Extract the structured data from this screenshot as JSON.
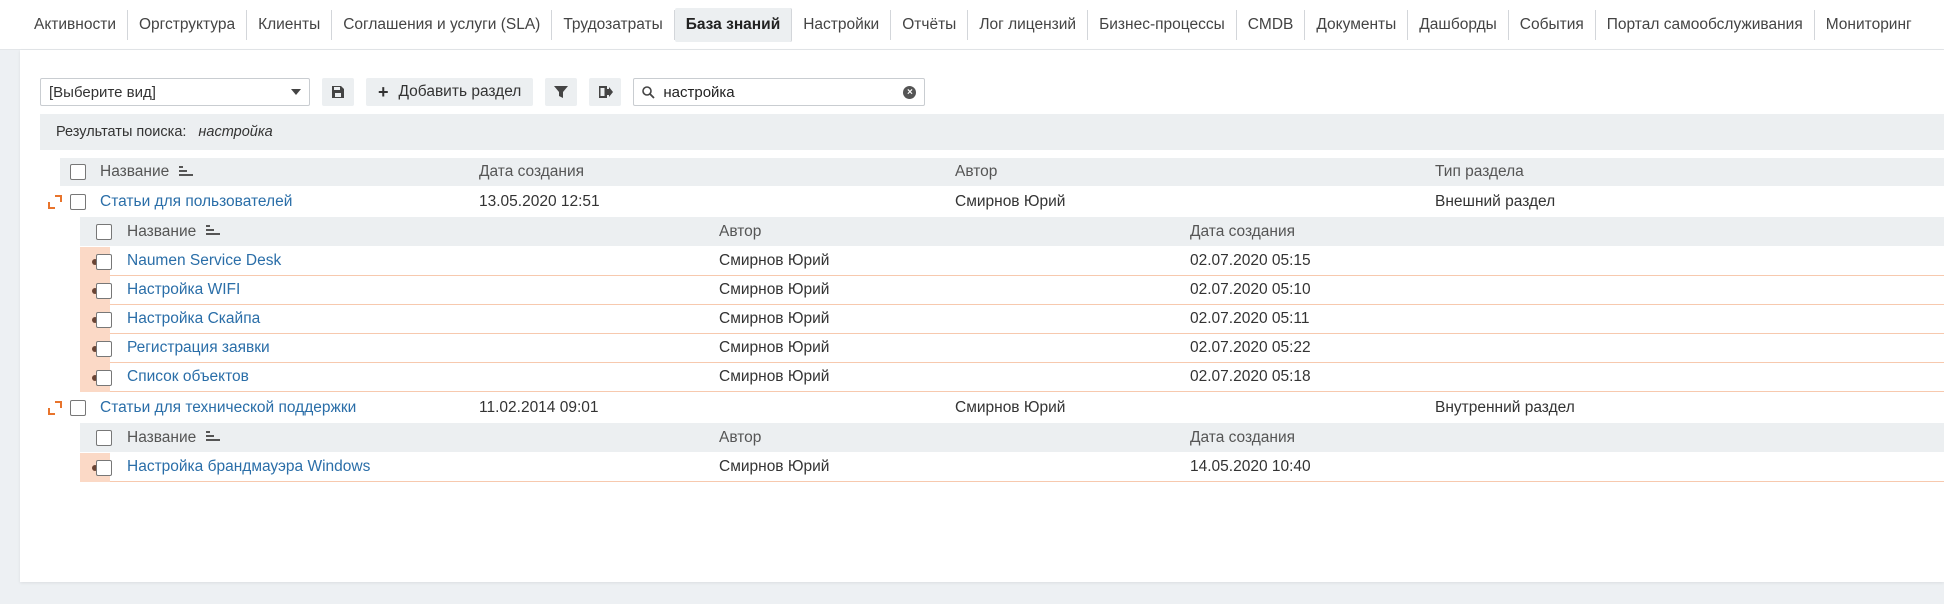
{
  "nav": {
    "tabs": [
      {
        "label": "Активности"
      },
      {
        "label": "Оргструктура"
      },
      {
        "label": "Клиенты"
      },
      {
        "label": "Соглашения и услуги (SLA)"
      },
      {
        "label": "Трудозатраты"
      },
      {
        "label": "База знаний",
        "active": true
      },
      {
        "label": "Настройки"
      },
      {
        "label": "Отчёты"
      },
      {
        "label": "Лог лицензий"
      },
      {
        "label": "Бизнес-процессы"
      },
      {
        "label": "CMDB"
      },
      {
        "label": "Документы"
      },
      {
        "label": "Дашборды"
      },
      {
        "label": "События"
      },
      {
        "label": "Портал самообслуживания"
      },
      {
        "label": "Мониторинг"
      }
    ]
  },
  "toolbar": {
    "view_select": "[Выберите вид]",
    "add_section_label": "Добавить раздел",
    "search_value": "настройка"
  },
  "search_results": {
    "label": "Результаты поиска:",
    "query": "настройка"
  },
  "table": {
    "columns": {
      "name": "Название",
      "created": "Дата создания",
      "author": "Автор",
      "type": "Тип раздела"
    },
    "child_columns": {
      "name": "Название",
      "author": "Автор",
      "created": "Дата создания"
    },
    "sections": [
      {
        "name": "Статьи для пользователей",
        "created": "13.05.2020 12:51",
        "author": "Смирнов Юрий",
        "type": "Внешний раздел",
        "articles": [
          {
            "name": "Naumen Service Desk",
            "author": "Смирнов Юрий",
            "created": "02.07.2020 05:15"
          },
          {
            "name": "Настройка WIFI",
            "author": "Смирнов Юрий",
            "created": "02.07.2020 05:10"
          },
          {
            "name": "Настройка Скайпа",
            "author": "Смирнов Юрий",
            "created": "02.07.2020 05:11"
          },
          {
            "name": "Регистрация заявки",
            "author": "Смирнов Юрий",
            "created": "02.07.2020 05:22"
          },
          {
            "name": "Список объектов",
            "author": "Смирнов Юрий",
            "created": "02.07.2020 05:18"
          }
        ]
      },
      {
        "name": "Статьи для технической поддержки",
        "created": "11.02.2014 09:01",
        "author": "Смирнов Юрий",
        "type": "Внутренний раздел",
        "articles": [
          {
            "name": "Настройка брандмауэра Windows",
            "author": "Смирнов Юрий",
            "created": "14.05.2020 10:40"
          }
        ]
      }
    ]
  },
  "colors": {
    "accent_link": "#2a6ea8",
    "child_marker": "#fbd9c6",
    "expand_icon": "#e8742c"
  }
}
